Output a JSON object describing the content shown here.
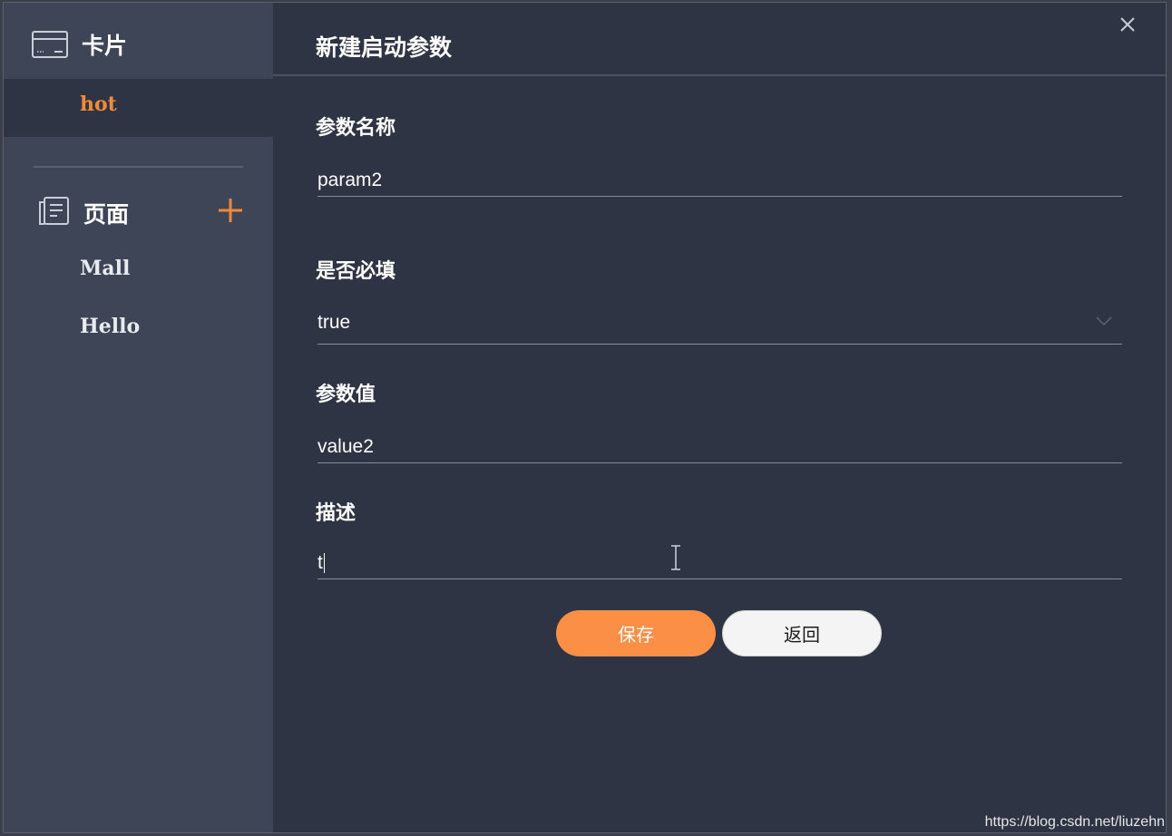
{
  "sidebar": {
    "card_section": {
      "icon": "card-icon",
      "title": "卡片",
      "active_item": "hot"
    },
    "page_section": {
      "icon": "pages-icon",
      "title": "页面",
      "add_icon": "plus-icon",
      "items": [
        "Mall",
        "Hello"
      ]
    }
  },
  "dialog": {
    "title": "新建启动参数",
    "close_icon": "close-icon",
    "fields": {
      "name": {
        "label": "参数名称",
        "value": "param2"
      },
      "required": {
        "label": "是否必填",
        "value": "true"
      },
      "value": {
        "label": "参数值",
        "value": "value2"
      },
      "description": {
        "label": "描述",
        "value": "t"
      }
    },
    "buttons": {
      "save": "保存",
      "back": "返回"
    }
  },
  "watermark": "https://blog.csdn.net/liuzehn",
  "colors": {
    "accent": "#fa8f45",
    "sidebar_bg": "#3d4557",
    "main_bg": "#2e3443",
    "active_text": "#f08a3c"
  }
}
